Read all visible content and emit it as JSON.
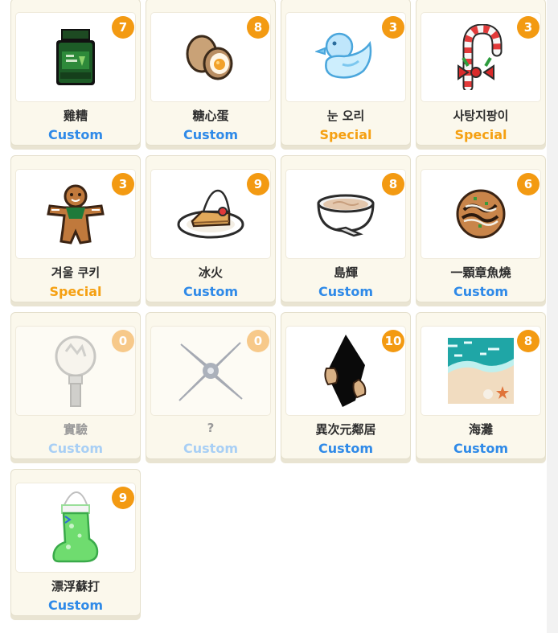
{
  "items": [
    {
      "name": "雞糟",
      "type": "Custom",
      "count": "7",
      "icon": "jar-icon",
      "locked": false
    },
    {
      "name": "糖心蛋",
      "type": "Custom",
      "count": "8",
      "icon": "egg-icon",
      "locked": false
    },
    {
      "name": "눈 오리",
      "type": "Special",
      "count": "3",
      "icon": "snow-duck-icon",
      "locked": false
    },
    {
      "name": "사탕지팡이",
      "type": "Special",
      "count": "3",
      "icon": "candy-cane-icon",
      "locked": false
    },
    {
      "name": "겨울 쿠키",
      "type": "Special",
      "count": "3",
      "icon": "gingerbread-icon",
      "locked": false
    },
    {
      "name": "冰火",
      "type": "Custom",
      "count": "9",
      "icon": "dessert-plate-icon",
      "locked": false
    },
    {
      "name": "島輝",
      "type": "Custom",
      "count": "8",
      "icon": "soup-bowl-icon",
      "locked": false
    },
    {
      "name": "一顆章魚燒",
      "type": "Custom",
      "count": "6",
      "icon": "takoyaki-icon",
      "locked": false
    },
    {
      "name": "實驗",
      "type": "Custom",
      "count": "0",
      "icon": "lightstick-icon",
      "locked": true
    },
    {
      "name": "?",
      "type": "Custom",
      "count": "0",
      "icon": "shuriken-icon",
      "locked": true
    },
    {
      "name": "異次元鄰居",
      "type": "Custom",
      "count": "10",
      "icon": "shadow-hands-icon",
      "locked": false
    },
    {
      "name": "海灘",
      "type": "Custom",
      "count": "8",
      "icon": "beach-icon",
      "locked": false
    },
    {
      "name": "漂浮蘇打",
      "type": "Custom",
      "count": "9",
      "icon": "soda-stocking-icon",
      "locked": false
    }
  ],
  "colors": {
    "custom": "#2f8ae8",
    "special": "#f5a012",
    "badge": "#f39a12",
    "card_bg": "#fbf8ec"
  }
}
